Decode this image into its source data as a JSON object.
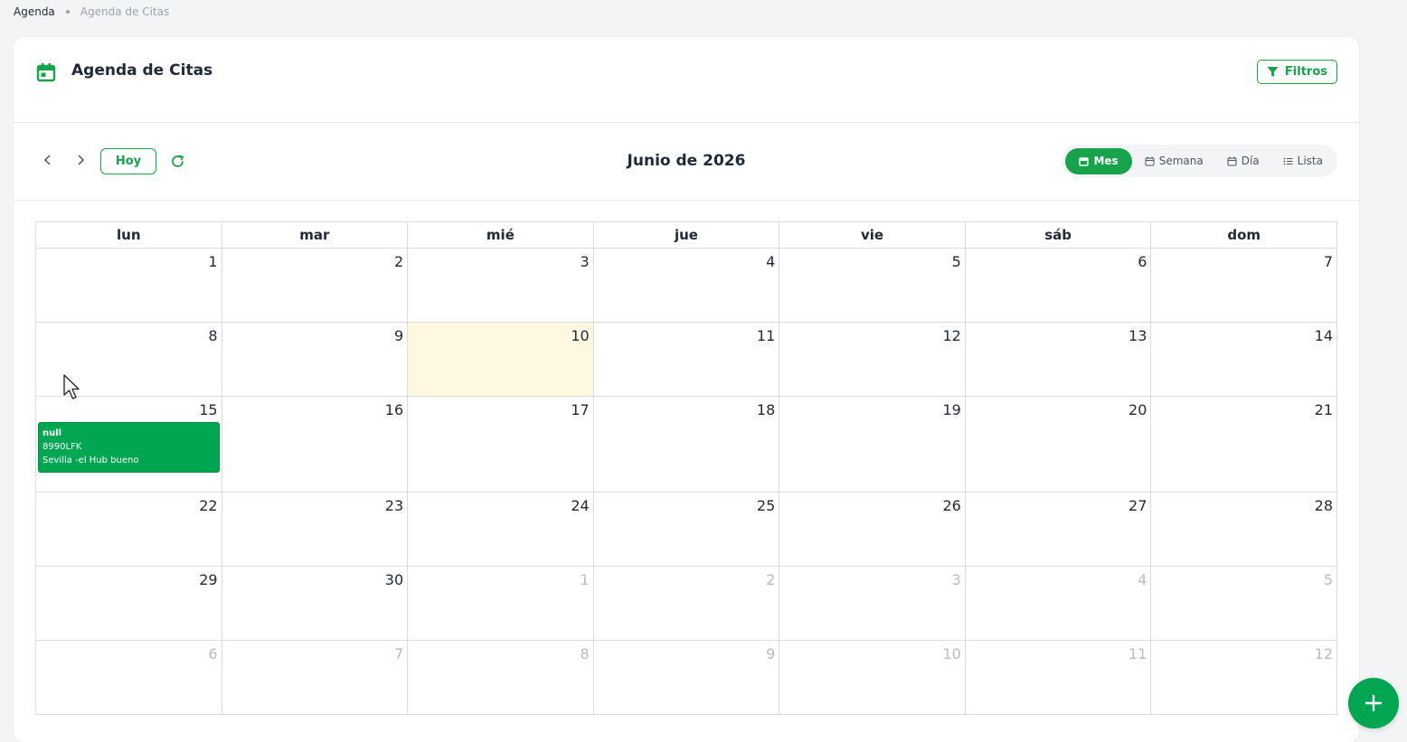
{
  "breadcrumb": {
    "root": "Agenda",
    "current": "Agenda de Citas"
  },
  "header": {
    "title": "Agenda de Citas",
    "filters_label": "Filtros"
  },
  "toolbar": {
    "today_label": "Hoy",
    "period_title": "Junio de 2026",
    "views": {
      "month": "Mes",
      "week": "Semana",
      "day": "Día",
      "list": "Lista"
    },
    "active_view": "Mes"
  },
  "weekdays": [
    "lun",
    "mar",
    "mié",
    "jue",
    "vie",
    "sáb",
    "dom"
  ],
  "weeks": [
    [
      {
        "d": "1"
      },
      {
        "d": "2"
      },
      {
        "d": "3"
      },
      {
        "d": "4"
      },
      {
        "d": "5"
      },
      {
        "d": "6"
      },
      {
        "d": "7"
      }
    ],
    [
      {
        "d": "8"
      },
      {
        "d": "9"
      },
      {
        "d": "10",
        "today": true
      },
      {
        "d": "11"
      },
      {
        "d": "12"
      },
      {
        "d": "13"
      },
      {
        "d": "14"
      }
    ],
    [
      {
        "d": "15",
        "event": {
          "title": "null",
          "plate": "8990LFK",
          "location": "Sevilla -el Hub bueno"
        }
      },
      {
        "d": "16"
      },
      {
        "d": "17"
      },
      {
        "d": "18"
      },
      {
        "d": "19"
      },
      {
        "d": "20"
      },
      {
        "d": "21"
      }
    ],
    [
      {
        "d": "22"
      },
      {
        "d": "23"
      },
      {
        "d": "24"
      },
      {
        "d": "25"
      },
      {
        "d": "26"
      },
      {
        "d": "27"
      },
      {
        "d": "28"
      }
    ],
    [
      {
        "d": "29"
      },
      {
        "d": "30"
      },
      {
        "d": "1",
        "other": true
      },
      {
        "d": "2",
        "other": true
      },
      {
        "d": "3",
        "other": true
      },
      {
        "d": "4",
        "other": true
      },
      {
        "d": "5",
        "other": true
      }
    ],
    [
      {
        "d": "6",
        "other": true
      },
      {
        "d": "7",
        "other": true
      },
      {
        "d": "8",
        "other": true
      },
      {
        "d": "9",
        "other": true
      },
      {
        "d": "10",
        "other": true
      },
      {
        "d": "11",
        "other": true
      },
      {
        "d": "12",
        "other": true
      }
    ]
  ],
  "colors": {
    "accent": "#16a34a",
    "event_bg": "#00a651",
    "today_bg": "#fef8e1"
  },
  "icons": {
    "title": "calendar-icon",
    "filter": "funnel-icon",
    "prev": "chevron-left-icon",
    "next": "chevron-right-icon",
    "refresh": "refresh-icon",
    "fab": "plus-icon"
  }
}
